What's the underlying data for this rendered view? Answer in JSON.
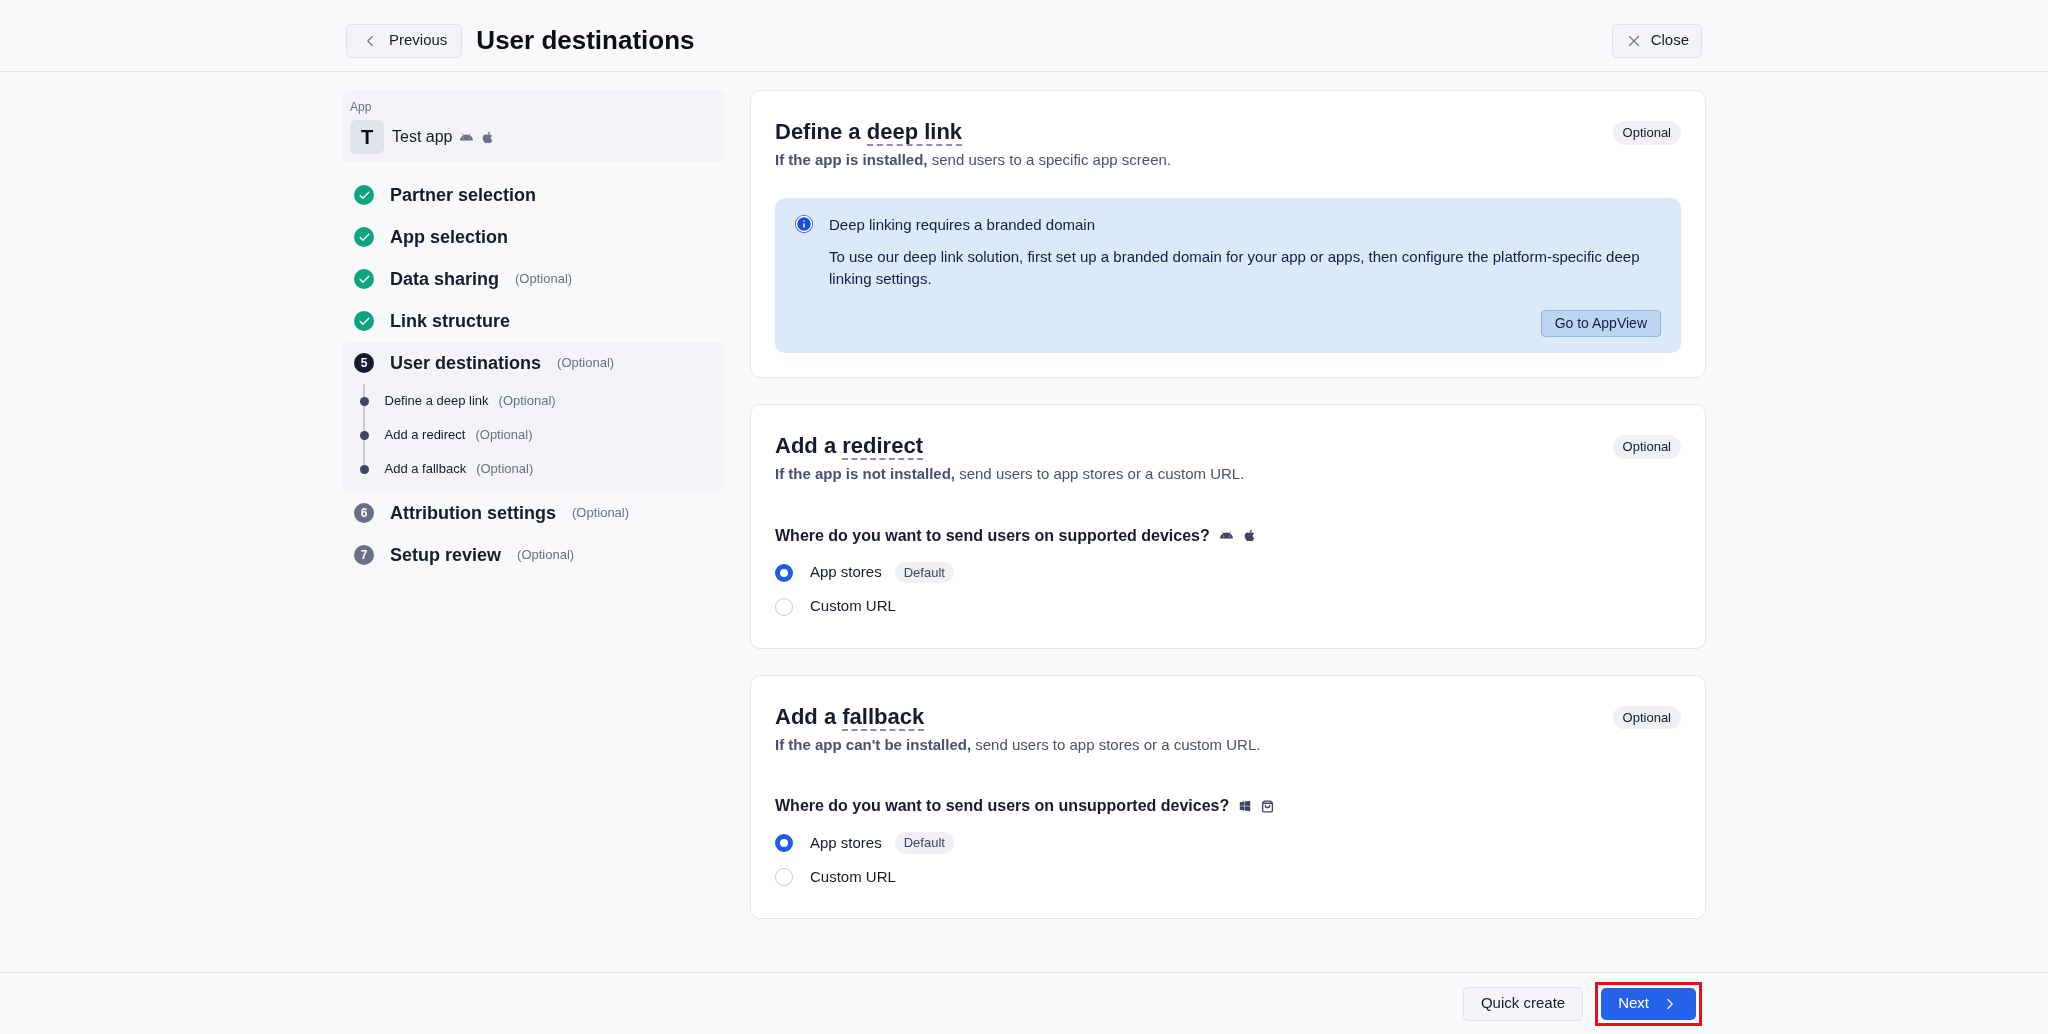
{
  "header": {
    "back_button": "Previous",
    "title": "User destinations",
    "close_button": "Close"
  },
  "sidebar": {
    "app": {
      "caption": "App",
      "initial": "T",
      "name": "Test app"
    },
    "steps": [
      {
        "label": "Partner selection",
        "kind": "done"
      },
      {
        "label": "App selection",
        "kind": "done"
      },
      {
        "label": "Data sharing",
        "note": "(Optional)",
        "kind": "done"
      },
      {
        "label": "Link structure",
        "kind": "done"
      },
      {
        "marker": "5",
        "label": "User destinations",
        "note": "(Optional)",
        "kind": "current",
        "children": [
          {
            "label": "Define a deep link",
            "note": "(Optional)"
          },
          {
            "label": "Add a redirect",
            "note": "(Optional)"
          },
          {
            "label": "Add a fallback",
            "note": "(Optional)"
          }
        ]
      },
      {
        "marker": "6",
        "label": "Attribution settings",
        "note": "(Optional)",
        "kind": "upcoming"
      },
      {
        "marker": "7",
        "label": "Setup review",
        "note": "(Optional)",
        "kind": "upcoming"
      }
    ]
  },
  "sections": [
    {
      "kind": "info",
      "title_prefix": "Define a",
      "term": "deep link",
      "badge": "Optional",
      "subtitle": "**If the app is installed,** send users to a specific app screen.",
      "notice": {
        "title": "Deep linking requires a branded domain",
        "text": "To use our deep link solution, first set up a branded domain for your app or apps, then configure the platform-specific deep linking settings.",
        "button": "Go to AppView"
      }
    },
    {
      "kind": "choice",
      "title_prefix": "Add a",
      "term": "redirect",
      "badge": "Optional",
      "subtitle": "**If the app is not installed,** send users to app stores or a custom URL.",
      "question": "Where do you want to send users on supported devices?",
      "options": [
        {
          "label": "App stores",
          "tag": "Default",
          "selected": true
        },
        {
          "label": "Custom URL",
          "selected": false
        }
      ]
    },
    {
      "kind": "choice",
      "title_prefix": "Add a",
      "term": "fallback",
      "badge": "Optional",
      "subtitle": "**If the app can't be installed,** send users to app stores or a custom URL.",
      "question": "Where do you want to send users on unsupported devices?",
      "options": [
        {
          "label": "App stores",
          "tag": "Default",
          "selected": true
        },
        {
          "label": "Custom URL",
          "selected": false
        }
      ]
    }
  ],
  "footer": {
    "secondary_button": "Quick create",
    "primary_button": "Next",
    "primary_highlighted": true
  }
}
